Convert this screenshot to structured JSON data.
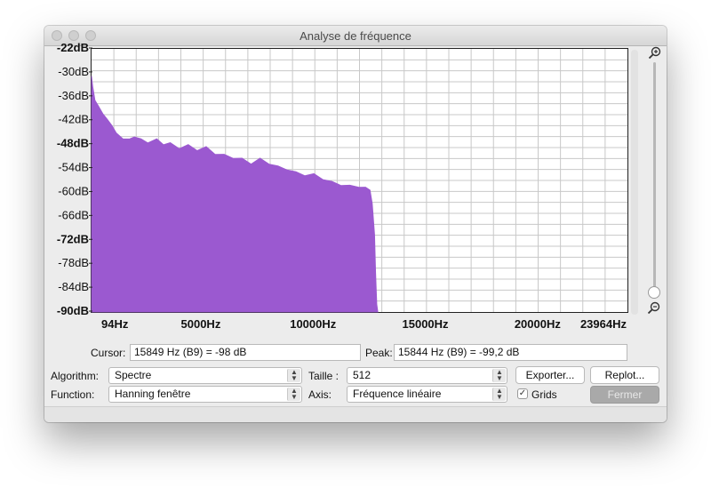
{
  "window": {
    "title": "Analyse de fréquence"
  },
  "chart_data": {
    "type": "area",
    "title": "",
    "xlabel": "",
    "ylabel": "",
    "x_ticks": [
      "94Hz",
      "5000Hz",
      "10000Hz",
      "15000Hz",
      "20000Hz",
      "23964Hz"
    ],
    "y_ticks": [
      "-22dB",
      "-30dB",
      "-36dB",
      "-42dB",
      "-48dB",
      "-54dB",
      "-60dB",
      "-66dB",
      "-72dB",
      "-78dB",
      "-84dB",
      "-90dB"
    ],
    "xlim": [
      94,
      23964
    ],
    "ylim": [
      -90,
      -22
    ],
    "grid": true,
    "color": "#9b59d0",
    "series": [
      {
        "x": [
          94,
          150,
          250,
          400,
          600,
          800,
          1000,
          1200,
          1500,
          1800,
          2000,
          2300,
          2600,
          3000,
          3300,
          3600,
          4000,
          4400,
          4800,
          5200,
          5600,
          6000,
          6400,
          6800,
          7200,
          7600,
          8000,
          8400,
          8800,
          9200,
          9600,
          10000,
          10400,
          10800,
          11200,
          11600,
          12000,
          12300,
          12500,
          12600,
          12700,
          12750,
          12800,
          12850
        ],
        "y": [
          -29,
          -32,
          -35,
          -37,
          -38.5,
          -40.5,
          -41.5,
          -44,
          -45,
          -45.5,
          -44.5,
          -45.5,
          -46,
          -45.5,
          -46.5,
          -46.5,
          -47.5,
          -47,
          -48,
          -47.5,
          -49,
          -49.5,
          -50,
          -50.5,
          -51.5,
          -50.5,
          -51.5,
          -52.5,
          -53,
          -54,
          -54.5,
          -54.5,
          -55.5,
          -56.5,
          -57,
          -57.5,
          -57.5,
          -58,
          -58.5,
          -62,
          -70,
          -80,
          -88,
          -90
        ]
      }
    ]
  },
  "readout": {
    "cursor_label": "Cursor:",
    "cursor_value": "15849 Hz (B9) = -98 dB",
    "peak_label": "Peak:",
    "peak_value": "15844 Hz (B9) = -99,2 dB"
  },
  "controls": {
    "algorithm_label": "Algorithm:",
    "algorithm_value": "Spectre",
    "function_label": "Function:",
    "function_value": "Hanning fenêtre",
    "size_label": "Taille :",
    "size_value": "512",
    "axis_label": "Axis:",
    "axis_value": "Fréquence linéaire",
    "export_button": "Exporter...",
    "replot_button": "Replot...",
    "grids_label": "Grids",
    "grids_checked": true,
    "close_button": "Fermer"
  },
  "icons": {
    "zoom_in": "zoom-in-icon",
    "zoom_out": "zoom-out-icon"
  }
}
